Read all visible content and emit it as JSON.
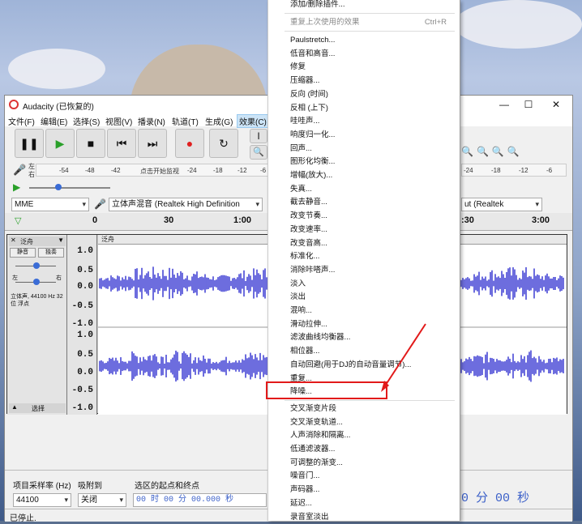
{
  "window": {
    "title": "Audacity (已恢复的)"
  },
  "menubar": [
    "文件(F)",
    "编辑(E)",
    "选择(S)",
    "视图(V)",
    "播录(N)",
    "轨道(T)",
    "生成(G)",
    "效果(C)"
  ],
  "meter": {
    "ticks": [
      "-54",
      "-48",
      "-42",
      "-24",
      "-18",
      "-12",
      "-6"
    ],
    "hint": "点击开始监视",
    "right_ticks": [
      "-24",
      "-18",
      "-12",
      "-6"
    ],
    "side_lr": [
      "左",
      "右"
    ]
  },
  "device": {
    "host": "MME",
    "input": "立体声混音 (Realtek High Definition",
    "output": "ut (Realtek"
  },
  "ruler": {
    "labels": [
      "0",
      "30",
      "1:00",
      ":30",
      "3:00"
    ]
  },
  "track": {
    "name": "泛舟",
    "name_short": "泛舟",
    "mute": "静音",
    "solo": "独奏",
    "left": "左",
    "right": "右",
    "info": "立体声, 44100 Hz 32位 浮点",
    "select": "选择",
    "scale": [
      "1.0",
      "0.5",
      "0.0",
      "-0.5",
      "-1.0"
    ]
  },
  "bottom": {
    "rate_label": "项目采样率 (Hz)",
    "snap_label": "吸附到",
    "sel_label": "选区的起点和终点",
    "rate_value": "44100",
    "snap_value": "关闭",
    "time_value": "00 时 00 分 00.000 秒",
    "right_time": "0 分 00 秒"
  },
  "status": "已停止.",
  "menu": {
    "items": [
      {
        "label": "添加/删除插件...",
        "disabled": false
      },
      {
        "label": "重复上次使用的效果",
        "shortcut": "Ctrl+R",
        "disabled": true
      },
      {
        "label": "Paulstretch..."
      },
      {
        "label": "低音和高音..."
      },
      {
        "label": "修复"
      },
      {
        "label": "压缩器..."
      },
      {
        "label": "反向 (时间)"
      },
      {
        "label": "反相 (上下)"
      },
      {
        "label": "哇哇声..."
      },
      {
        "label": "响度归一化..."
      },
      {
        "label": "回声..."
      },
      {
        "label": "图形化均衡..."
      },
      {
        "label": "增幅(放大)..."
      },
      {
        "label": "失真..."
      },
      {
        "label": "截去静音..."
      },
      {
        "label": "改变节奏..."
      },
      {
        "label": "改变速率..."
      },
      {
        "label": "改变音高..."
      },
      {
        "label": "标准化..."
      },
      {
        "label": "消除咔嗒声..."
      },
      {
        "label": "淡入"
      },
      {
        "label": "淡出"
      },
      {
        "label": "混响..."
      },
      {
        "label": "滑动拉伸..."
      },
      {
        "label": "滤波曲线均衡器..."
      },
      {
        "label": "相位器..."
      },
      {
        "label": "自动回避(用于DJ的自动音量调节)..."
      },
      {
        "label": "重复..."
      },
      {
        "label": "降噪..."
      },
      {
        "label": "交叉渐变片段"
      },
      {
        "label": "交叉渐变轨道..."
      },
      {
        "label": "人声消除和隔离..."
      },
      {
        "label": "低通滤波器..."
      },
      {
        "label": "可调整的渐变..."
      },
      {
        "label": "噪音门..."
      },
      {
        "label": "声码器..."
      },
      {
        "label": "延迟..."
      },
      {
        "label": "录音室淡出"
      }
    ]
  },
  "colors": {
    "highlight": "#e21a1a",
    "waveform": "#3c3cd2",
    "accent": "#cce4f7"
  }
}
